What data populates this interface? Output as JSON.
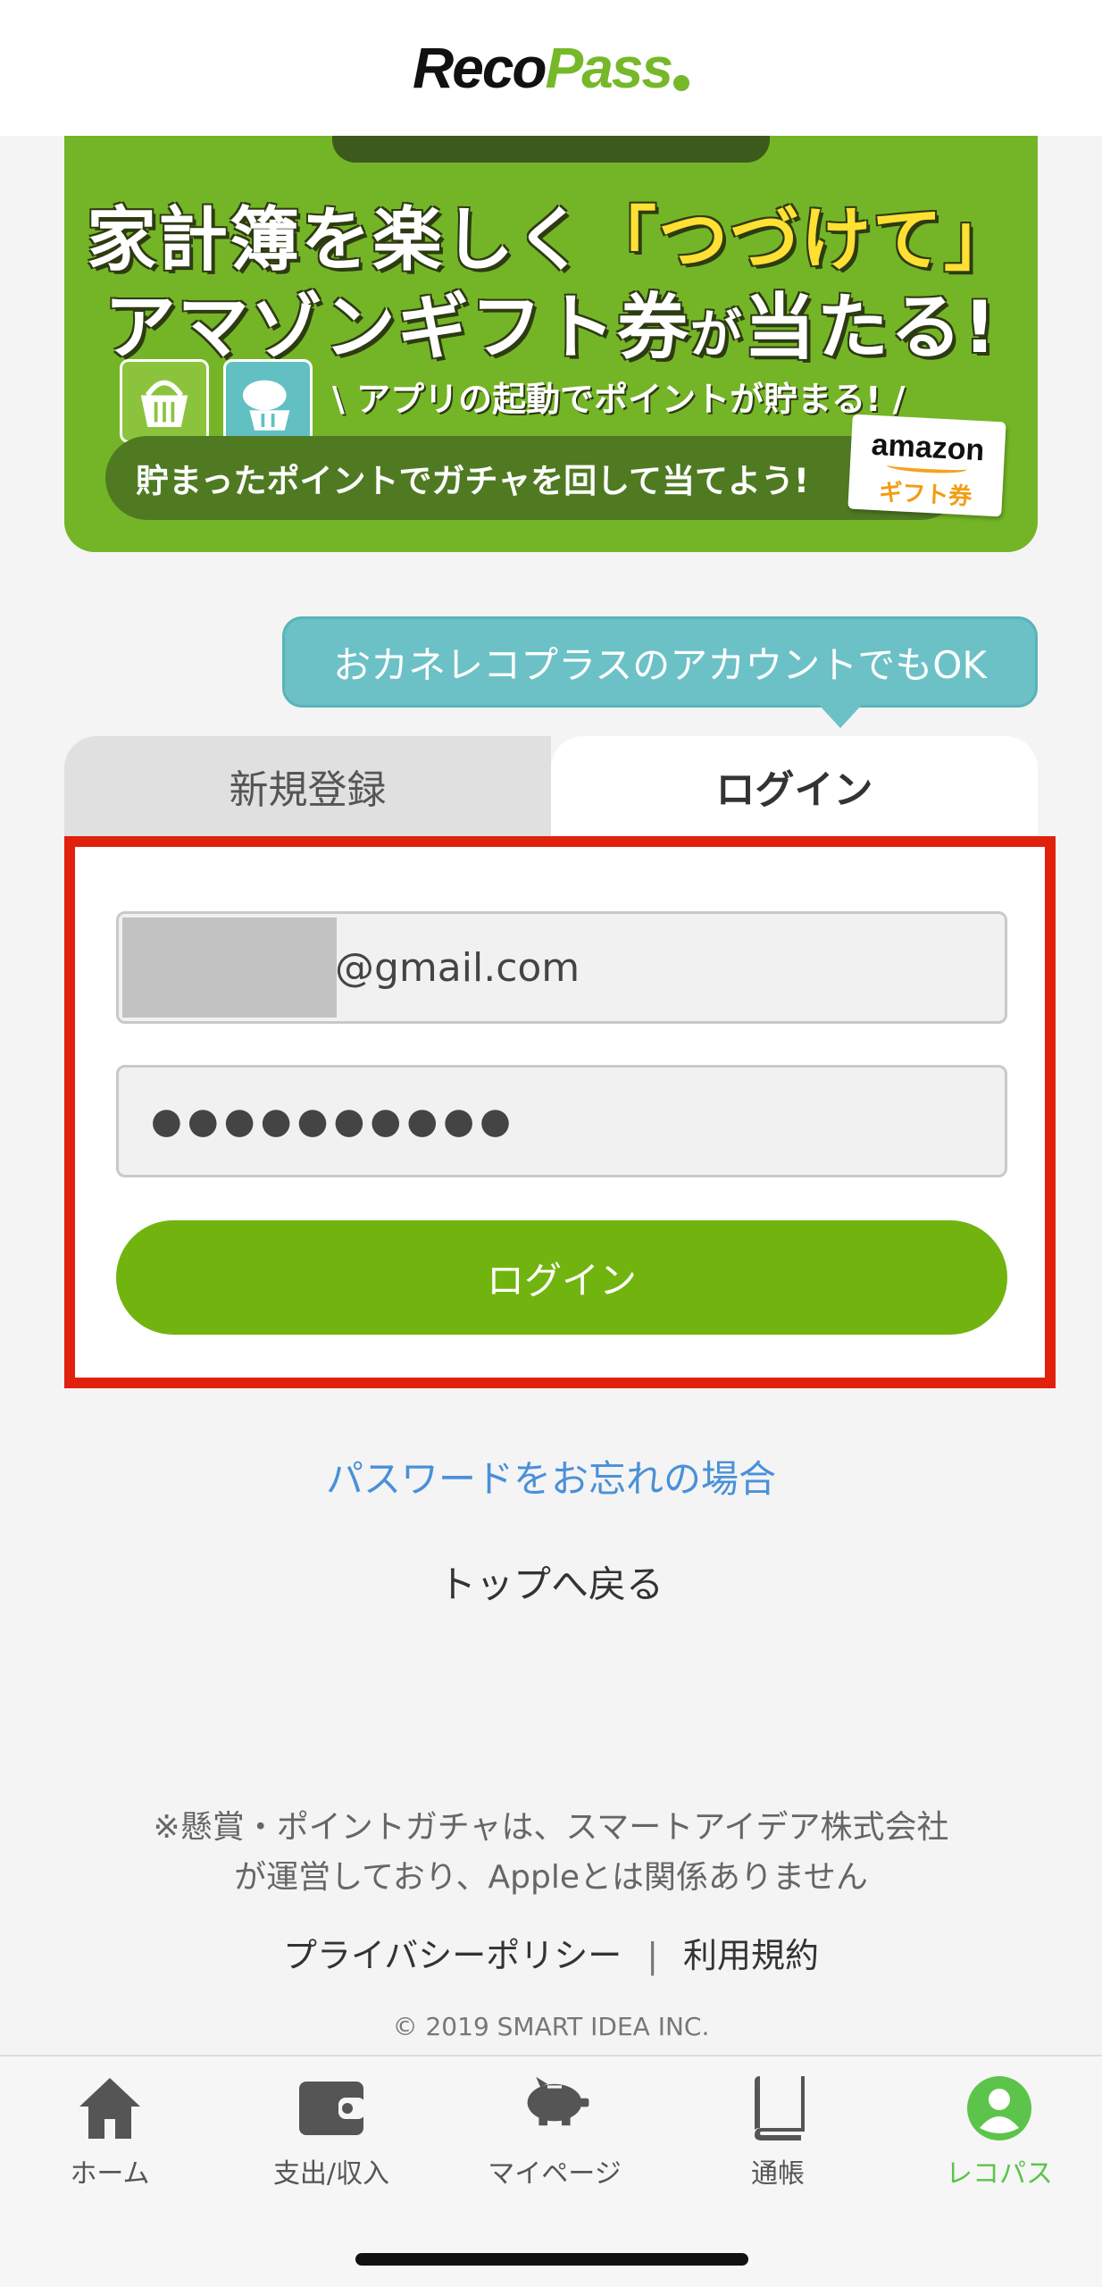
{
  "header": {
    "logo_reco": "Reco",
    "logo_pass": "Pass"
  },
  "banner": {
    "line1_a": "家計簿を楽しく",
    "line1_highlight": "「つづけて」",
    "line2_a": "アマゾンギフト券",
    "line2_small": "が",
    "line2_b": "当たる!",
    "subtitle": "\\ アプリの起動でポイントが貯まる! /",
    "pill_text": "貯まったポイントでガチャを回して当てよう!",
    "amazon_text": "amazon",
    "gift_text": "ギフト券"
  },
  "callout": {
    "text": "おカネレコプラスのアカウントでもOK"
  },
  "tabs": {
    "register": "新規登録",
    "login": "ログイン"
  },
  "form": {
    "email_value": "@gmail.com",
    "password_value": "●●●●●●●●●●",
    "login_button": "ログイン"
  },
  "links": {
    "forgot_password": "パスワードをお忘れの場合",
    "back_to_top": "トップへ戻る",
    "privacy": "プライバシーポリシー",
    "separator": "|",
    "terms": "利用規約"
  },
  "notice": {
    "line1": "※懸賞・ポイントガチャは、スマートアイデア株式会社",
    "line2": "が運営しており、Appleとは関係ありません"
  },
  "copyright": "© 2019 SMART IDEA INC.",
  "bottom_nav": [
    {
      "label": "ホーム",
      "icon": "home-icon"
    },
    {
      "label": "支出/収入",
      "icon": "wallet-icon"
    },
    {
      "label": "マイページ",
      "icon": "piggy-bank-icon"
    },
    {
      "label": "通帳",
      "icon": "book-icon"
    },
    {
      "label": "レコパス",
      "icon": "user-circle-icon",
      "active": true
    }
  ],
  "colors": {
    "accent_green": "#72b40f",
    "highlight_red": "#e0210d",
    "callout_teal": "#6cc1c6",
    "link_blue": "#4a90d9"
  }
}
